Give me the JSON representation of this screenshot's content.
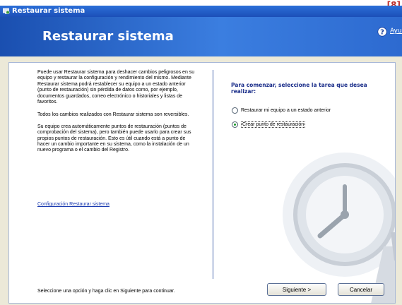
{
  "corner_tag": "[8]",
  "window": {
    "title": "Restaurar sistema"
  },
  "header": {
    "title": "Restaurar sistema",
    "help_link": "Ayuda"
  },
  "left": {
    "para1": "Puede usar Restaurar sistema para deshacer cambios peligrosos en su equipo y restaurar la configuración y rendimiento del mismo. Mediante Restaurar sistema podrá restablecer su equipo a un estado anterior (punto de restauración) sin pérdida de datos como, por ejemplo, documentos guardados, correo electrónico o historiales y listas de favoritos.",
    "para2": "Todos los cambios realizados con Restaurar sistema son reversibles.",
    "para3": "Su equipo crea automáticamente puntos de restauración (puntos de comprobación del sistema), pero también puede usarlo para crear sus propios puntos de restauración. Esto es útil cuando está a punto de hacer un cambio importante en su sistema, como la instalación de un nuevo programa o el cambio del Registro.",
    "config_link": "Configuración Restaurar sistema"
  },
  "right": {
    "prompt": "Para comenzar, seleccione la tarea que desea realizar:",
    "options": [
      {
        "label": "Restaurar mi equipo a un estado anterior",
        "checked": false
      },
      {
        "label": "Crear punto de restauración",
        "checked": true
      }
    ]
  },
  "footer": {
    "instruction": "Seleccione una opción y haga clic en Siguiente para continuar.",
    "next_label": "Siguiente >",
    "cancel_label": "Cancelar"
  },
  "colors": {
    "header_blue": "#2d6ad0",
    "titlebar_blue": "#1c4fb8",
    "link_blue": "#1b3bb0",
    "prompt_blue": "#1b2e8a",
    "tag_red": "#c0302a"
  }
}
